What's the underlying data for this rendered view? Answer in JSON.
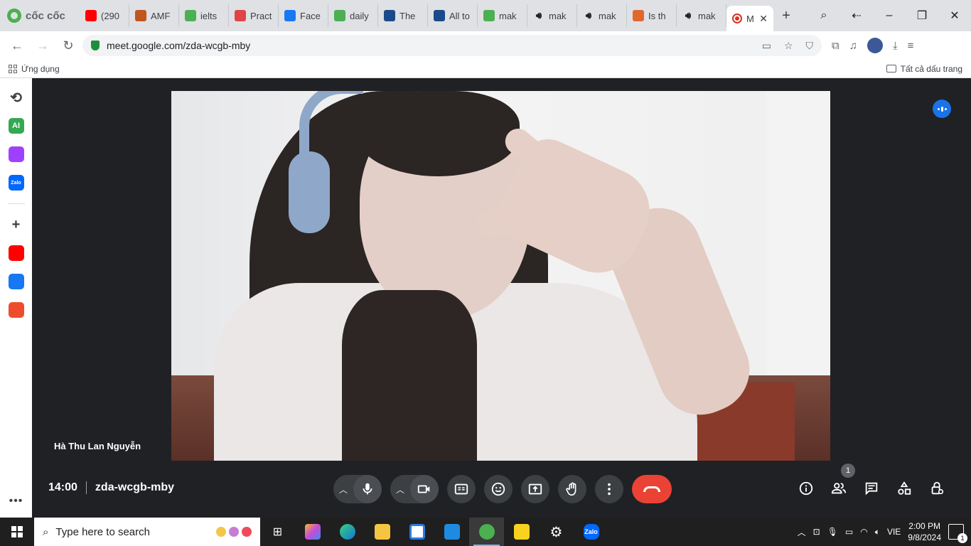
{
  "browser": {
    "brand": "cốc cốc",
    "tabs": [
      {
        "label": "(290",
        "icon": "youtube-icon",
        "color": "#ff0000"
      },
      {
        "label": "AMF",
        "icon": "shield-crest-icon",
        "color": "#c2541f"
      },
      {
        "label": "ielts",
        "icon": "coccoc-leaf-icon",
        "color": "#4caf50"
      },
      {
        "label": "Pract",
        "icon": "practice-icon",
        "color": "#e04444"
      },
      {
        "label": "Face",
        "icon": "facebook-icon",
        "color": "#1877f2"
      },
      {
        "label": "daily",
        "icon": "coccoc-leaf-icon",
        "color": "#4caf50"
      },
      {
        "label": "The",
        "icon": "d-logo-icon",
        "color": "#1a4a8a"
      },
      {
        "label": "All to",
        "icon": "d-logo-icon",
        "color": "#1a4a8a"
      },
      {
        "label": "mak",
        "icon": "coccoc-leaf-icon",
        "color": "#4caf50"
      },
      {
        "label": "mak",
        "icon": "speaker-icon",
        "color": "#202124"
      },
      {
        "label": "mak",
        "icon": "speaker-icon",
        "color": "#202124"
      },
      {
        "label": "Is th",
        "icon": "fire-icon",
        "color": "#e0682d"
      },
      {
        "label": "mak",
        "icon": "speaker-icon",
        "color": "#202124"
      }
    ],
    "active_tab": {
      "label": "M",
      "icon": "recording-icon"
    },
    "url": "meet.google.com/zda-wcgb-mby",
    "bookmarks": {
      "apps": "Ứng dụng",
      "all": "Tất cả dấu trang"
    }
  },
  "sidepanel": {
    "items": [
      {
        "icon": "history-icon",
        "label": ""
      },
      {
        "icon": "ai-icon",
        "label": "AI",
        "color": "#34a853"
      },
      {
        "icon": "messenger-icon",
        "label": "",
        "color": "#a040ff"
      },
      {
        "icon": "zalo-icon",
        "label": "Zalo",
        "color": "#0068ff"
      },
      {
        "icon": "add-icon",
        "label": ""
      },
      {
        "icon": "youtube-icon",
        "label": "",
        "color": "#ff0000"
      },
      {
        "icon": "facebook-icon",
        "label": "",
        "color": "#1877f2"
      },
      {
        "icon": "shopee-icon",
        "label": "",
        "color": "#ee4d2d"
      }
    ]
  },
  "meet": {
    "participant_name": "Hà Thu Lan Nguyễn",
    "time": "14:00",
    "meeting_code": "zda-wcgb-mby",
    "participants_count": "1",
    "colors": {
      "end_call": "#ea4335",
      "accent": "#1a73e8",
      "control_bg": "#3c4043"
    }
  },
  "taskbar": {
    "search_placeholder": "Type here to search",
    "language": "VIE",
    "time": "2:00 PM",
    "date": "9/8/2024",
    "notifications": "1"
  }
}
